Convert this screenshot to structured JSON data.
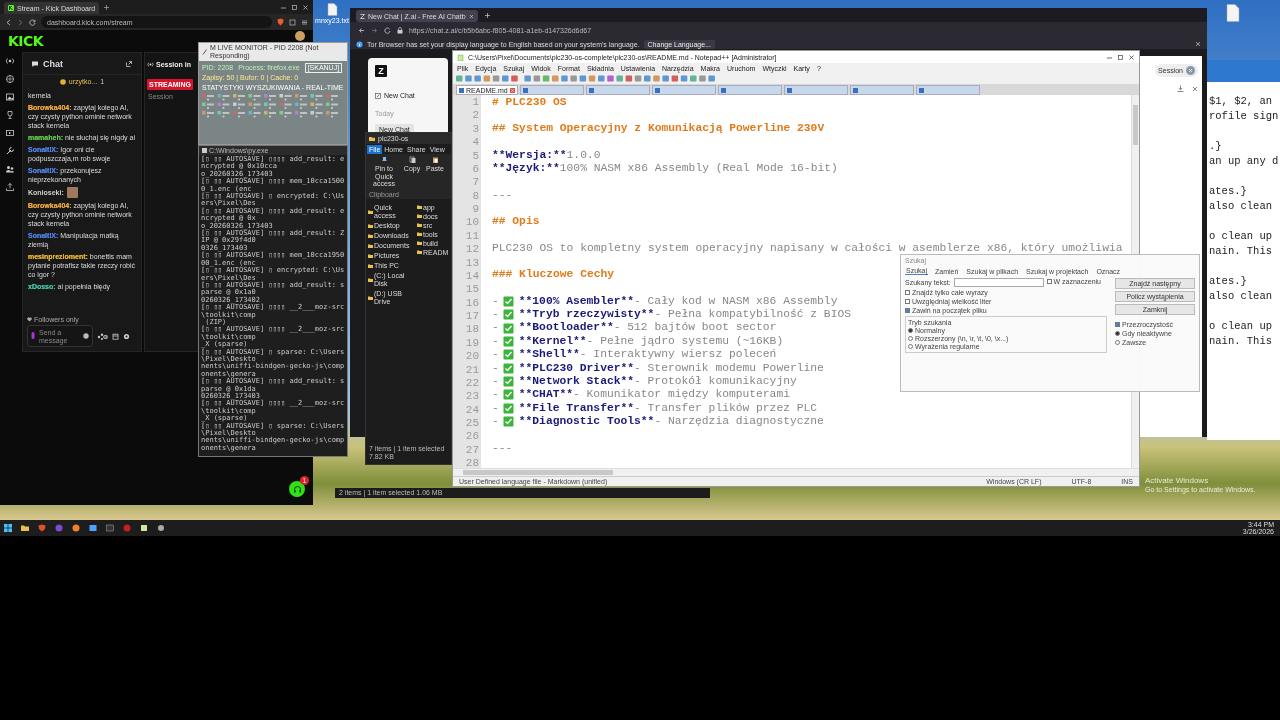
{
  "desktop": {
    "icon_label": "mnxy23.txt",
    "activation_title": "Activate Windows",
    "activation_hint": "Go to Settings to activate Windows."
  },
  "kick_window": {
    "tab_title": "Stream - Kick Dashboard",
    "url": "dashboard.kick.com/stream",
    "logo": "KICK",
    "chat": {
      "title": "Chat",
      "pinned": "urzytko...",
      "pinned_count": "1",
      "messages": [
        {
          "kind": "continuation",
          "text": "kernela"
        },
        {
          "kind": "message",
          "user": "Borowka404:",
          "color": "#e8a33d",
          "text": "zapytaj kolego AI, czy czysty python ominie network stack kernela"
        },
        {
          "kind": "message",
          "user": "mamaheh:",
          "color": "#5fbf4a",
          "text": "nie słuchaj się nigdy ai"
        },
        {
          "kind": "message",
          "user": "SonaltIX:",
          "color": "#4f7fe0",
          "text": "Igor oni cie podpuszczaja,m rob swoje"
        },
        {
          "kind": "message",
          "user": "SonaltIX:",
          "color": "#4f7fe0",
          "text": "przekonujesz nieprzekonanych"
        },
        {
          "kind": "emote",
          "user": "Konioseki:",
          "color": "#d0d0d0"
        },
        {
          "kind": "message",
          "user": "Borowka404:",
          "color": "#e8a33d",
          "text": "zapytaj kolego AI, czy czysty python ominie network stack kernela"
        },
        {
          "kind": "message",
          "user": "SonaltIX:",
          "color": "#4f7fe0",
          "text": "Manipulacja matką ziemią"
        },
        {
          "kind": "message",
          "user": "mesinprezioment:",
          "color": "#e0b030",
          "text": "bonettis mam pytanie potrafisz takie rzeczy robić co igor ?"
        },
        {
          "kind": "message",
          "user": "xDosso:",
          "color": "#3fbfa0",
          "text": "ai popełnia błędy"
        }
      ],
      "mode": "Followers only",
      "input_placeholder": "Send a message"
    },
    "session": {
      "title": "Session in",
      "status": "STREAMING",
      "label": "Session"
    },
    "support_badge": "1"
  },
  "monitor_window": {
    "title": "M LIVE MONITOR - PID 2208 (Not Responding)",
    "pid": "PID: 2208",
    "process": "Process: firefox.exe",
    "scan_button": "[SKANUJ]",
    "counters": "Zapisy: 50 | Bufor: 0 | Cache: 0",
    "stats_title": "STATYSTYKI WYSZUKIWANIA - REAL-TIME"
  },
  "terminal_window": {
    "title": "C:\\Windows\\py.exe",
    "lines": [
      "[▯ ▯▯ AUTOSAVE] ▯▯▯▯ add_result: encrypted @ 0x10cca",
      "o_20260326_173403",
      "[▯ ▯▯ AUTOSAVE] ▯▯▯▯ mem_10cca15000_1.enc (enc",
      "[▯ ▯▯ AUTOSAVE] ▯ encrypted: C:\\Users\\Pixel\\Des",
      "[▯ ▯▯ AUTOSAVE] ▯▯▯▯ add_result: encrypted @ 0x",
      "o_20260326_173403",
      "[▯ ▯▯ AUTOSAVE] ▯▯▯▯ add_result: ZIP @ 0x29f4d0",
      "0326_173403",
      "[▯ ▯▯ AUTOSAVE] ▯▯▯▯ mem_10cca195000_1.enc (enc",
      "[▯ ▯▯ AUTOSAVE] ▯ encrypted: C:\\Users\\Pixel\\Des",
      "[▯ ▯▯ AUTOSAVE] ▯▯▯▯ add_result: sparse @ 0x1a0",
      "0260326_173402",
      "[▯ ▯▯ AUTOSAVE] ▯▯▯▯ __2___moz-src\\toolkit\\comp",
      " (ZIP)",
      "[▯ ▯▯ AUTOSAVE] ▯▯▯▯ __2___moz-src\\toolkit\\comp",
      "_X (sparse)",
      "[▯ ▯▯ AUTOSAVE] ▯ sparse: C:\\Users\\Pixel\\Deskto",
      "nents\\uniffi-bindgen-gecko-js\\components\\genera",
      "[▯ ▯▯ AUTOSAVE] ▯▯▯▯ add_result: sparse @ 0x1da",
      "0260326_173403",
      "[▯ ▯▯ AUTOSAVE] ▯▯▯▯ __2___moz-src\\toolkit\\comp",
      "_X (sparse)",
      "[▯ ▯▯ AUTOSAVE] ▯ sparse: C:\\Users\\Pixel\\Deskto",
      "nents\\uniffi-bindgen-gecko-js\\components\\genera"
    ]
  },
  "browser_window": {
    "tab_title": "New Chat | Z.ai - Free AI Chatb",
    "url": "https://chat.z.ai/c/b5b6abc-f805-4081-a1eb-d147326d6d67",
    "notice": "Tor Browser has set your display language to English based on your system's language.",
    "notice_button": "Change Language...",
    "logo": "Z",
    "new_chat": "New Chat",
    "section": "Today",
    "history": [
      {
        "label": "New Chat",
        "selected": true
      }
    ],
    "session_button": "Session"
  },
  "explorer_window": {
    "title": "plc230-os",
    "ribbon_tabs": [
      {
        "label": "File",
        "selected": true
      },
      {
        "label": "Home",
        "selected": false
      },
      {
        "label": "Share",
        "selected": false
      },
      {
        "label": "View",
        "selected": false
      }
    ],
    "ribbon_buttons": [
      "Pin to Quick access",
      "Copy",
      "Paste"
    ],
    "ribbon_group": "Clipboard",
    "tree": [
      "Quick access",
      "Desktop",
      "Downloads",
      "Documents",
      "Pictures",
      "This PC",
      "(C:) Local Disk",
      "(D:) USB Drive"
    ],
    "files": [
      "app",
      "docs",
      "src",
      "tools",
      "build",
      "READM"
    ],
    "status": "7 items | 1 item selected 7.82 KB",
    "status_2": "2 items | 1 item selected 1.06 MB"
  },
  "editor_window": {
    "title": "C:\\Users\\Pixel\\Documents\\plc230-os-complete\\plc230-os\\README.md - Notepad++ [Administrator]",
    "menu": [
      "Plik",
      "Edycja",
      "Szukaj",
      "Widok",
      "Format",
      "Składnia",
      "Ustawienia",
      "Narzędzia",
      "Makra",
      "Uruchom",
      "Wtyczki",
      "Karty",
      "?"
    ],
    "tabs": [
      {
        "label": "README.md",
        "selected": true
      },
      {
        "selected": false
      },
      {
        "selected": false
      },
      {
        "selected": false
      },
      {
        "selected": false
      },
      {
        "selected": false
      },
      {
        "selected": false
      },
      {
        "selected": false
      }
    ],
    "lines": [
      {
        "kind": "heading",
        "n": "1",
        "text": "# PLC230 OS"
      },
      {
        "kind": "blank",
        "n": "2"
      },
      {
        "kind": "heading",
        "n": "3",
        "text": "## System Operacyjny z Komunikacją Powerline 230V"
      },
      {
        "kind": "blank",
        "n": "4"
      },
      {
        "kind": "meta",
        "n": "5",
        "key": "**Wersja:**",
        "value": "1.0.0"
      },
      {
        "kind": "meta",
        "n": "6",
        "key": "**Język:**",
        "value": "100% NASM x86 Assembly (Real Mode 16-bit)"
      },
      {
        "kind": "blank",
        "n": "7"
      },
      {
        "kind": "rule",
        "n": "8",
        "text": "---"
      },
      {
        "kind": "blank",
        "n": "9"
      },
      {
        "kind": "heading",
        "n": "10",
        "text": "## Opis"
      },
      {
        "kind": "blank",
        "n": "11"
      },
      {
        "kind": "text",
        "n": "12",
        "text": "PLC230 OS to kompletny system operacyjny napisany w całości w asemblerze x86, który umożliwia"
      },
      {
        "kind": "blank",
        "n": "13"
      },
      {
        "kind": "heading",
        "n": "14",
        "text": "### Kluczowe Cechy"
      },
      {
        "kind": "blank",
        "n": "15"
      },
      {
        "kind": "feature",
        "n": "16",
        "bullet": "-",
        "name": "**100% Asembler**",
        "desc": "- Cały kod w NASM x86 Assembly"
      },
      {
        "kind": "feature",
        "n": "17",
        "bullet": "-",
        "name": "**Tryb rzeczywisty**",
        "desc": "- Pełna kompatybilność z BIOS"
      },
      {
        "kind": "feature",
        "n": "18",
        "bullet": "-",
        "name": "**Bootloader**",
        "desc": "- 512 bajtów boot sector"
      },
      {
        "kind": "feature",
        "n": "19",
        "bullet": "-",
        "name": "**Kernel**",
        "desc": "- Pełne jądro systemu (~16KB)"
      },
      {
        "kind": "feature",
        "n": "20",
        "bullet": "-",
        "name": "**Shell**",
        "desc": "- Interaktywny wiersz poleceń"
      },
      {
        "kind": "feature",
        "n": "21",
        "bullet": "-",
        "name": "**PLC230 Driver**",
        "desc": "- Sterownik modemu Powerline"
      },
      {
        "kind": "feature",
        "n": "22",
        "bullet": "-",
        "name": "**Network Stack**",
        "desc": "- Protokół komunikacyjny"
      },
      {
        "kind": "feature",
        "n": "23",
        "bullet": "-",
        "name": "**CHAT**",
        "desc": "- Komunikator między komputerami"
      },
      {
        "kind": "feature",
        "n": "24",
        "bullet": "-",
        "name": "**File Transfer**",
        "desc": "- Transfer plików przez PLC"
      },
      {
        "kind": "feature",
        "n": "25",
        "bullet": "-",
        "name": "**Diagnostic Tools**",
        "desc": "- Narzędzia diagnostyczne"
      },
      {
        "kind": "blank",
        "n": "26"
      },
      {
        "kind": "rule",
        "n": "27",
        "text": "---"
      },
      {
        "kind": "blank",
        "n": "28"
      }
    ],
    "status": [
      "User Defined language file - Markdown (unified)",
      "Windows (CR LF)",
      "UTF-8",
      "INS"
    ]
  },
  "find_dialog": {
    "title": "Szukaj",
    "tabs": [
      {
        "label": "Szukaj",
        "selected": true
      },
      {
        "label": "Zamień",
        "selected": false
      },
      {
        "label": "Szukaj w plikach",
        "selected": false
      },
      {
        "label": "Szukaj w projektach",
        "selected": false
      },
      {
        "label": "Oznacz",
        "selected": false
      }
    ],
    "field_label": "Szukany tekst:",
    "buttons": [
      "Znajdź następny",
      "Policz wystąpienia",
      "Zamknij"
    ],
    "in_selection": {
      "label": "W zaznaczeniu",
      "checked": false
    },
    "options": [
      {
        "label": "Znajdź tylko całe wyrazy",
        "checked": false
      },
      {
        "label": "Uwzględniaj wielkość liter",
        "checked": false
      },
      {
        "label": "Zawiń na początek pliku",
        "checked": true
      }
    ],
    "mode_title": "Tryb szukania",
    "modes": [
      {
        "label": "Normalny",
        "selected": true
      },
      {
        "label": "Rozszerzony (\\n, \\r, \\t, \\0, \\x...)",
        "selected": false
      },
      {
        "label": "Wyrażenia regularne",
        "selected": false
      }
    ],
    "transparency": {
      "label": "Przezroczystość",
      "checked": true
    },
    "transparency_modes": [
      {
        "label": "Gdy nieaktywne",
        "selected": true
      },
      {
        "label": "Zawsze",
        "selected": false
      }
    ]
  },
  "side_terminal": {
    "paragraphs": [
      [
        "$1, $2, an",
        "rofile sign"
      ],
      [
        ".}",
        "an up any d"
      ],
      [
        "ates.}",
        "also clean"
      ],
      [
        "o clean up",
        "nain. This"
      ],
      [
        "ates.}",
        "also clean"
      ],
      [
        "o clean up",
        "nain. This"
      ]
    ]
  },
  "taskbar": {
    "time": "3:44 PM",
    "date": "3/26/2026"
  }
}
